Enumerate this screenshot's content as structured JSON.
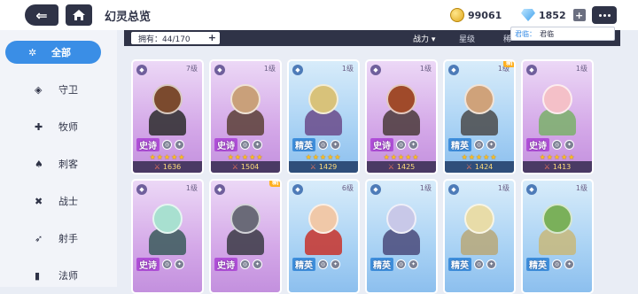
{
  "header": {
    "title": "幻灵总览",
    "gold": "99061",
    "gems": "1852"
  },
  "sidebar": {
    "items": [
      {
        "label": "全部",
        "icon": "star-burst-icon",
        "glyph": "✲",
        "active": true
      },
      {
        "label": "守卫",
        "icon": "shield-icon",
        "glyph": "◈",
        "active": false
      },
      {
        "label": "牧师",
        "icon": "heal-icon",
        "glyph": "✚",
        "active": false
      },
      {
        "label": "刺客",
        "icon": "dagger-icon",
        "glyph": "♠",
        "active": false
      },
      {
        "label": "战士",
        "icon": "axe-icon",
        "glyph": "✖",
        "active": false
      },
      {
        "label": "射手",
        "icon": "arrow-icon",
        "glyph": "➶",
        "active": false
      },
      {
        "label": "法师",
        "icon": "spellbook-icon",
        "glyph": "▮",
        "active": false
      }
    ]
  },
  "filter": {
    "count_label": "拥有：44/170",
    "sort_power": "战力 ▾",
    "sort_stars": "星级",
    "sort_rarity": "稀",
    "tooltip_key": "君临：",
    "tooltip_val": "君临"
  },
  "cards": [
    {
      "rarity": "史诗",
      "tier": "epic",
      "level": "7级",
      "stars": "★★★★★",
      "power": "1636",
      "new": false,
      "skin": "#7b4a2e",
      "body": "#2b2b2b"
    },
    {
      "rarity": "史诗",
      "tier": "epic",
      "level": "1级",
      "stars": "★★★★★",
      "power": "1504",
      "new": false,
      "skin": "#c9a07a",
      "body": "#5a4036"
    },
    {
      "rarity": "精英",
      "tier": "elite",
      "level": "1级",
      "stars": "★★★★★",
      "power": "1429",
      "new": false,
      "skin": "#d8c27a",
      "body": "#6a4a8a"
    },
    {
      "rarity": "史诗",
      "tier": "epic",
      "level": "1级",
      "stars": "★★★★★",
      "power": "1425",
      "new": false,
      "skin": "#a04a2a",
      "body": "#4a3a3a"
    },
    {
      "rarity": "精英",
      "tier": "elite",
      "level": "1级",
      "stars": "★★★★★",
      "power": "1424",
      "new": true,
      "skin": "#cfa27a",
      "body": "#4a4a4a"
    },
    {
      "rarity": "史诗",
      "tier": "epic",
      "level": "1级",
      "stars": "★★★★★",
      "power": "1413",
      "new": false,
      "skin": "#f4c0c8",
      "body": "#7ab06a"
    },
    {
      "rarity": "史诗",
      "tier": "epic",
      "level": "1级",
      "stars": "",
      "power": "",
      "new": false,
      "skin": "#a8e0d0",
      "body": "#3a5a5a"
    },
    {
      "rarity": "史诗",
      "tier": "epic",
      "level": "",
      "stars": "",
      "power": "",
      "new": true,
      "skin": "#6a6a78",
      "body": "#3a3a44"
    },
    {
      "rarity": "精英",
      "tier": "elite",
      "level": "6级",
      "stars": "",
      "power": "",
      "new": false,
      "skin": "#f0c8a8",
      "body": "#c8322a"
    },
    {
      "rarity": "精英",
      "tier": "elite",
      "level": "1级",
      "stars": "",
      "power": "",
      "new": false,
      "skin": "#c8c8e8",
      "body": "#4a4a7a"
    },
    {
      "rarity": "精英",
      "tier": "elite",
      "level": "1级",
      "stars": "",
      "power": "",
      "new": false,
      "skin": "#e8dca8",
      "body": "#b8a878"
    },
    {
      "rarity": "精英",
      "tier": "elite",
      "level": "1级",
      "stars": "",
      "power": "",
      "new": false,
      "skin": "#7ab05a",
      "body": "#c8b87a"
    }
  ]
}
